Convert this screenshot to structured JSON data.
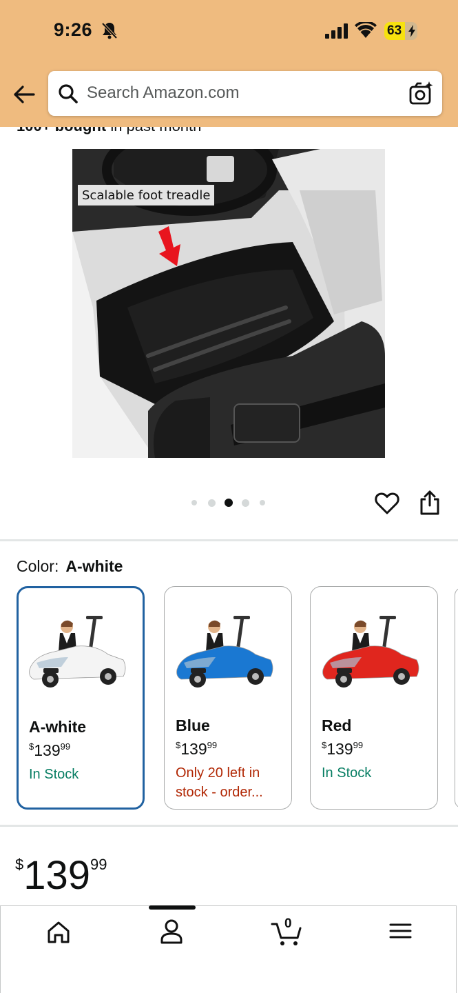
{
  "status_bar": {
    "time": "9:26",
    "battery": "63",
    "battery_level": 0.63
  },
  "search": {
    "placeholder": "Search Amazon.com"
  },
  "bought": {
    "bold": "100+ bought",
    "rest": "in past month"
  },
  "product_image": {
    "caption": "Scalable foot treadle"
  },
  "carousel": {
    "dot_count": 5,
    "active_index": 2
  },
  "color": {
    "label": "Color:",
    "selected": "A-white",
    "options": [
      {
        "name": "A-white",
        "price_whole": "139",
        "price_fraction": "99",
        "currency": "$",
        "stock": "In Stock",
        "car_color": "#f4f4f4",
        "stock_color": "#067d62"
      },
      {
        "name": "Blue",
        "price_whole": "139",
        "price_fraction": "99",
        "currency": "$",
        "stock": "Only 20 left in stock - order...",
        "car_color": "#1a78d2",
        "stock_color": "#b12704"
      },
      {
        "name": "Red",
        "price_whole": "139",
        "price_fraction": "99",
        "currency": "$",
        "stock": "In Stock",
        "car_color": "#e0261e",
        "stock_color": "#067d62"
      }
    ]
  },
  "price": {
    "currency": "$",
    "whole": "139",
    "fraction": "99"
  },
  "bottom_nav": {
    "items": [
      "home-icon",
      "account-icon",
      "cart-icon",
      "menu-icon"
    ],
    "cart_count": "0"
  },
  "colors": {
    "header": "#efbb7f",
    "selected_border": "#2162a1",
    "in_stock": "#067d62",
    "low_stock": "#b12704"
  }
}
